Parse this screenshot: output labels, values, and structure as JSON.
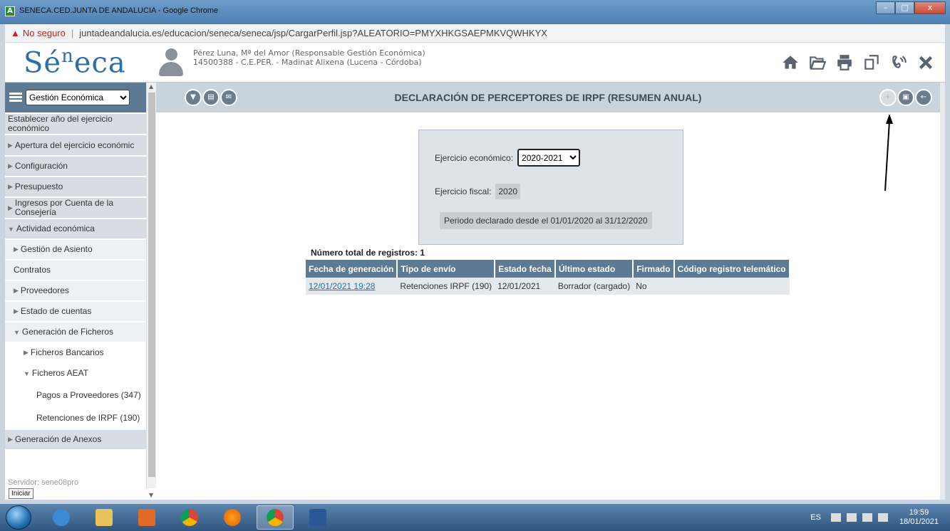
{
  "window": {
    "title": "SENECA.CED.JUNTA DE ANDALUCIA - Google Chrome",
    "app_icon": "A",
    "minimize": "–",
    "maximize": "□",
    "close": "x"
  },
  "address": {
    "security": "No seguro",
    "separator": "|",
    "url": "juntadeandalucia.es/educacion/seneca/seneca/jsp/CargarPerfil.jsp?ALEATORIO=PMYXHKGSAEPMKVQWHKYX"
  },
  "header": {
    "logo_main": "Sé",
    "logo_sup": "n",
    "logo_tail": "eca",
    "user_line1": "Pérez Luna, Mª del Amor (Responsable Gestión Económica)",
    "user_line2": "14500388 - C.E.PER. - Madinat Alixena (Lucena - Córdoba)",
    "icons": [
      "home-icon",
      "folder-open-icon",
      "print-icon",
      "windows-icon",
      "sound-icon",
      "close-icon"
    ]
  },
  "sidebar": {
    "menu_select": "Gestión Económica",
    "items": [
      {
        "label": "Establecer año del ejercicio económico",
        "level": 0,
        "tri": ""
      },
      {
        "label": "Apertura del ejercicio económic",
        "level": 0,
        "tri": "▶"
      },
      {
        "label": "Configuración",
        "level": 0,
        "tri": "▶"
      },
      {
        "label": "Presupuesto",
        "level": 0,
        "tri": "▶"
      },
      {
        "label": "Ingresos por Cuenta de la Consejería",
        "level": 0,
        "tri": "▶"
      },
      {
        "label": "Actividad económica",
        "level": 0,
        "tri": "▼"
      },
      {
        "label": "Gestión de Asiento",
        "level": 1,
        "tri": "▶"
      },
      {
        "label": "Contratos",
        "level": 1,
        "tri": ""
      },
      {
        "label": "Proveedores",
        "level": 1,
        "tri": "▶"
      },
      {
        "label": "Estado de cuentas",
        "level": 1,
        "tri": "▶"
      },
      {
        "label": "Generación de Ficheros",
        "level": 1,
        "tri": "▼"
      },
      {
        "label": "Ficheros Bancarios",
        "level": 2,
        "tri": "▶"
      },
      {
        "label": "Ficheros AEAT",
        "level": 2,
        "tri": "▼"
      },
      {
        "label": "Pagos a Proveedores (347)",
        "level": 3,
        "tri": ""
      },
      {
        "label": "Retenciones de IRPF (190)",
        "level": 3,
        "tri": ""
      },
      {
        "label": "Generación de Anexos",
        "level": 0,
        "tri": "▶"
      }
    ],
    "servidor": "Servidor: sene08pro",
    "iniciar": "Iniciar"
  },
  "main": {
    "title": "DECLARACIÓN DE PERCEPTORES DE IRPF (RESUMEN ANUAL)",
    "filter": {
      "ejercicio_label": "Ejercicio económico:",
      "ejercicio_value": "2020-2021",
      "fiscal_label": "Ejercicio fiscal:",
      "fiscal_value": "2020",
      "periodo": "Periodo declarado desde el 01/01/2020 al 31/12/2020"
    },
    "total": "Número total de registros: 1",
    "table": {
      "headers": [
        "Fecha de generación",
        "Tipo de envío",
        "Estado fecha",
        "Último estado",
        "Firmado",
        "Código registro telemático"
      ],
      "rows": [
        [
          "12/01/2021 19:28",
          "Retenciones IRPF (190)",
          "12/01/2021",
          "Borrador (cargado)",
          "No",
          ""
        ]
      ]
    }
  },
  "taskbar": {
    "lang": "ES",
    "time": "19:59",
    "date": "18/01/2021"
  }
}
